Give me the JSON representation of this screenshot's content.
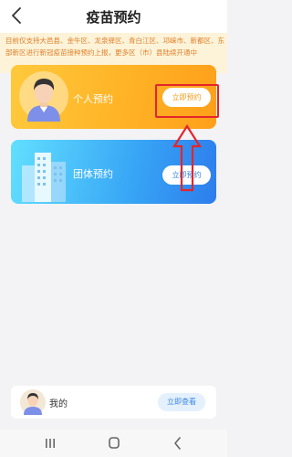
{
  "header": {
    "back_icon": "chevron-left-icon",
    "title": "疫苗预约"
  },
  "notice": {
    "text": "目前仅支持大邑县、金牛区、龙泉驿区、青白江区、邛崃市、新都区、东部新区进行新冠疫苗接种预约上报，更多区（市）县陆续开通中"
  },
  "cards": [
    {
      "label": "个人预约",
      "button": "立即预约",
      "icon": "person-avatar-icon",
      "accent": "#ffb326"
    },
    {
      "label": "团体预约",
      "button": "立即预约",
      "icon": "buildings-icon",
      "accent": "#37a5f5"
    }
  ],
  "annotation": {
    "color": "#e5252b",
    "icon": "up-arrow-icon"
  },
  "mine": {
    "label": "我的",
    "button": "立即查看",
    "icon": "person-avatar-icon"
  },
  "navbar": {
    "items": [
      "menu-icon",
      "home-icon",
      "back-icon"
    ]
  }
}
